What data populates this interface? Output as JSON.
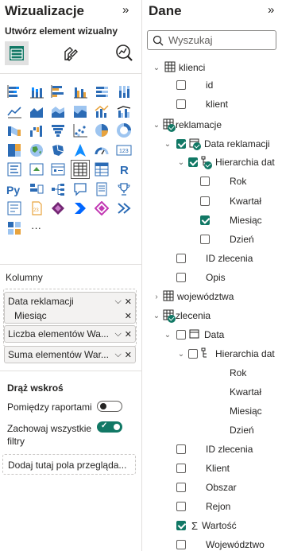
{
  "viz_panel": {
    "title": "Wizualizacje",
    "collapse_glyph": "»",
    "build_label": "Utwórz element wizualny",
    "more_label": "···",
    "wells": {
      "columns_label": "Kolumny",
      "fields": [
        {
          "label": "Data reklamacji"
        },
        {
          "label": "Miesiąc"
        },
        {
          "label": "Liczba elementów Wa..."
        },
        {
          "label": "Suma elementów War..."
        }
      ]
    },
    "drillthrough": {
      "title": "Drąż wskroś",
      "cross_report_label": "Pomiędzy raportami",
      "cross_report_state": "off",
      "keep_filters_label": "Zachowaj wszystkie filtry",
      "keep_filters_state": "on",
      "drop_placeholder": "Dodaj tutaj pola przegląda..."
    }
  },
  "data_panel": {
    "title": "Dane",
    "collapse_glyph": "»",
    "search_placeholder": "Wyszukaj",
    "tree": [
      {
        "label": "klienci",
        "type": "table",
        "level": 0,
        "expanded": true
      },
      {
        "label": "id",
        "type": "field",
        "level": 1,
        "checked": false
      },
      {
        "label": "klient",
        "type": "field",
        "level": 1,
        "checked": false
      },
      {
        "label": "reklamacje",
        "type": "table",
        "level": 0,
        "expanded": true,
        "badge": true
      },
      {
        "label": "Data reklamacji",
        "type": "date",
        "level": 1,
        "expanded": true,
        "checked": true,
        "badge": true
      },
      {
        "label": "Hierarchia dat",
        "type": "hierarchy",
        "level": 2,
        "expanded": true,
        "checked": true,
        "badge": true
      },
      {
        "label": "Rok",
        "type": "field",
        "level": 3,
        "checked": false
      },
      {
        "label": "Kwartał",
        "type": "field",
        "level": 3,
        "checked": false
      },
      {
        "label": "Miesiąc",
        "type": "field",
        "level": 3,
        "checked": true
      },
      {
        "label": "Dzień",
        "type": "field",
        "level": 3,
        "checked": false
      },
      {
        "label": "ID zlecenia",
        "type": "field",
        "level": 1,
        "checked": false
      },
      {
        "label": "Opis",
        "type": "field",
        "level": 1,
        "checked": false
      },
      {
        "label": "województwa",
        "type": "table",
        "level": 0,
        "expanded": false
      },
      {
        "label": "zlecenia",
        "type": "table",
        "level": 0,
        "expanded": true,
        "badge": true
      },
      {
        "label": "Data",
        "type": "date",
        "level": 1,
        "expanded": true,
        "checked": false
      },
      {
        "label": "Hierarchia dat",
        "type": "hierarchy",
        "level": 2,
        "expanded": true,
        "checked": false
      },
      {
        "label": "Rok",
        "type": "field",
        "level": 3,
        "plain": true
      },
      {
        "label": "Kwartał",
        "type": "field",
        "level": 3,
        "plain": true
      },
      {
        "label": "Miesiąc",
        "type": "field",
        "level": 3,
        "plain": true
      },
      {
        "label": "Dzień",
        "type": "field",
        "level": 3,
        "plain": true
      },
      {
        "label": "ID zlecenia",
        "type": "field",
        "level": 1,
        "checked": false
      },
      {
        "label": "Klient",
        "type": "field",
        "level": 1,
        "checked": false
      },
      {
        "label": "Obszar",
        "type": "field",
        "level": 1,
        "checked": false
      },
      {
        "label": "Rejon",
        "type": "field",
        "level": 1,
        "checked": false
      },
      {
        "label": "Wartość",
        "type": "measure",
        "level": 1,
        "checked": true
      },
      {
        "label": "Województwo",
        "type": "field",
        "level": 1,
        "checked": false
      }
    ]
  },
  "colors": {
    "accent": "#117865",
    "text": "#252423",
    "border": "#c8c6c4"
  }
}
